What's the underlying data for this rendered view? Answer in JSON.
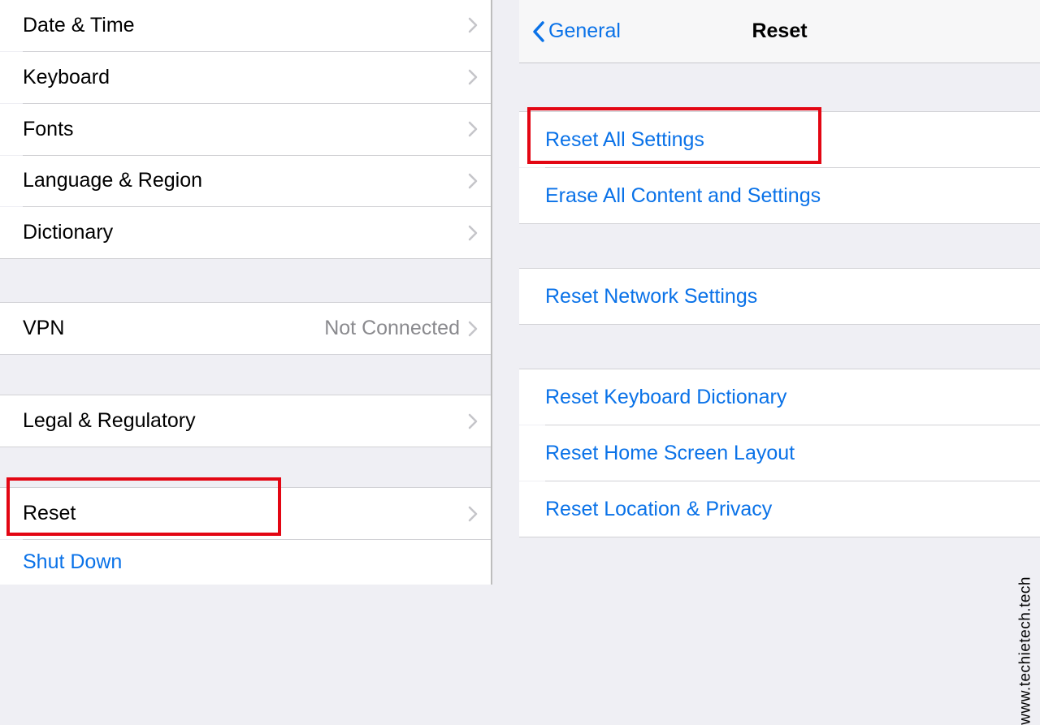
{
  "left": {
    "items_group1": [
      {
        "label": "Date & Time"
      },
      {
        "label": "Keyboard"
      },
      {
        "label": "Fonts"
      },
      {
        "label": "Language & Region"
      },
      {
        "label": "Dictionary"
      }
    ],
    "vpn": {
      "label": "VPN",
      "value": "Not Connected"
    },
    "legal": {
      "label": "Legal & Regulatory"
    },
    "reset": {
      "label": "Reset"
    },
    "shutdown": {
      "label": "Shut Down"
    }
  },
  "right": {
    "back_label": "General",
    "title": "Reset",
    "group1": [
      {
        "label": "Reset All Settings"
      },
      {
        "label": "Erase All Content and Settings"
      }
    ],
    "group2": [
      {
        "label": "Reset Network Settings"
      }
    ],
    "group3": [
      {
        "label": "Reset Keyboard Dictionary"
      },
      {
        "label": "Reset Home Screen Layout"
      },
      {
        "label": "Reset Location & Privacy"
      }
    ]
  },
  "watermark": "www.techietech.tech",
  "colors": {
    "link_blue": "#0a72e8",
    "highlight_red": "#e30613",
    "bg_gray": "#efeff4"
  }
}
